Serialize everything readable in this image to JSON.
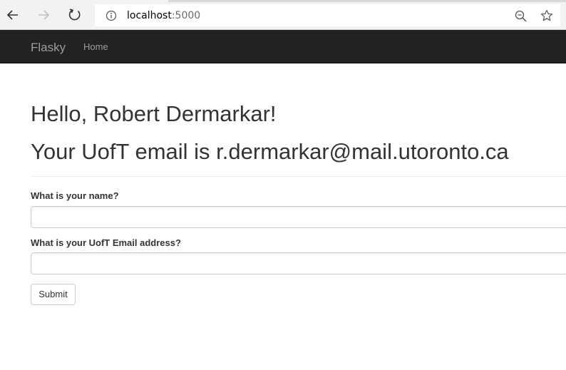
{
  "browser": {
    "url_host": "localhost",
    "url_port": ":5000",
    "icons": [
      "back-arrow-icon",
      "forward-arrow-icon",
      "refresh-icon",
      "info-icon",
      "zoom-out-icon",
      "star-icon"
    ]
  },
  "navbar": {
    "brand": "Flasky",
    "links": [
      {
        "label": "Home"
      }
    ],
    "background": "#222222",
    "link_color": "#9d9d9d"
  },
  "main": {
    "greeting": "Hello, Robert Dermarkar!",
    "email_message": "Your UofT email is r.dermarkar@mail.utoronto.ca"
  },
  "form": {
    "name_label": "What is your name?",
    "name_value": "",
    "email_label": "What is your UofT Email address?",
    "email_value": "",
    "submit_label": "Submit"
  }
}
